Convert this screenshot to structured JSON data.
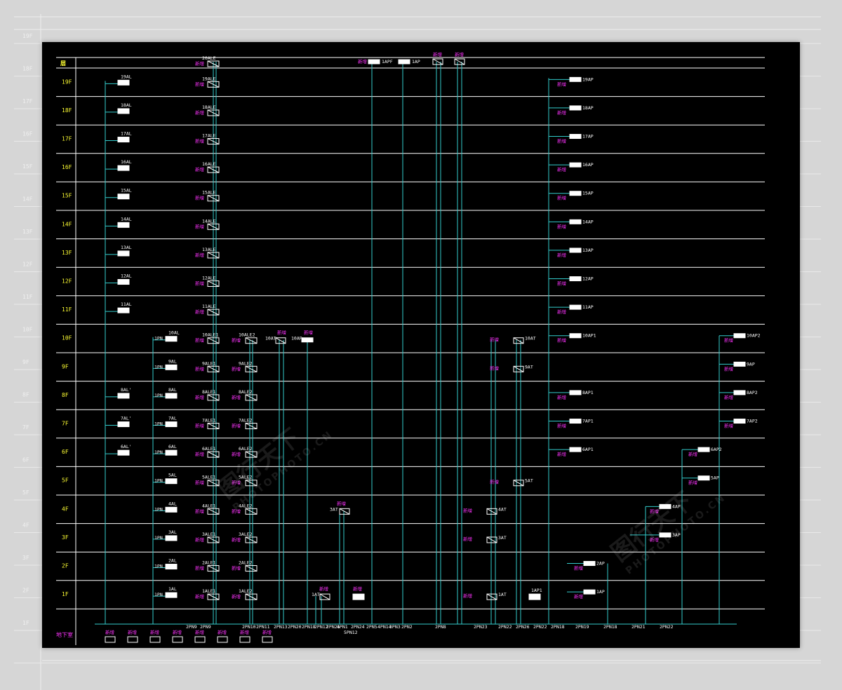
{
  "colors": {
    "page_bg": "#d6d6d6",
    "panel_bg": "#000000",
    "grid_line": "#ffffff",
    "riser": "#33cccc",
    "floor_label": "#ffff33",
    "magenta_label": "#ff33ff",
    "white_label": "#ffffff"
  },
  "header": {
    "corner_label": "层",
    "bottom_label": "地下室"
  },
  "floors": [
    "19F",
    "18F",
    "17F",
    "16F",
    "15F",
    "14F",
    "13F",
    "12F",
    "11F",
    "10F",
    "9F",
    "8F",
    "7F",
    "6F",
    "5F",
    "4F",
    "3F",
    "2F",
    "1F"
  ],
  "columns": {
    "lighting": [
      "19AL",
      "18AL",
      "17AL",
      "16AL",
      "15AL",
      "14AL",
      "13AL",
      "12AL",
      "11AL",
      "8AL'",
      "7AL'",
      "6AL'"
    ],
    "lighting_b": [
      "10AL",
      "9AL",
      "8AL",
      "7AL",
      "6AL",
      "5AL",
      "4AL",
      "3AL",
      "2AL",
      "1AL"
    ],
    "lighting_b_prefix": "1PN",
    "emergency": [
      "20ALE",
      "19ALE",
      "18ALE",
      "17ALE",
      "16ALE",
      "15ALE",
      "14ALE",
      "13ALE",
      "12ALE",
      "11ALE",
      "10ALE1",
      "9ALE1",
      "8ALE1",
      "7ALE1",
      "6ALE1",
      "5ALE1",
      "4ALE1",
      "3ALE1",
      "2ALE1",
      "1ALE1"
    ],
    "emergency_2": [
      "10ALE2",
      "9ALE2",
      "8ALE2",
      "7ALE2",
      "6ALE2",
      "5ALE2",
      "4ALE2",
      "3ALE2",
      "2ALE2",
      "1ALE2"
    ],
    "power_right": [
      "19AP",
      "18AP",
      "17AP",
      "16AP",
      "15AP",
      "14AP",
      "13AP",
      "12AP",
      "11AP",
      "10AP1",
      "8AP1",
      "7AP1",
      "6AP1"
    ],
    "power_far": [
      "10AP2",
      "9AP",
      "8AP2",
      "7AP2",
      "6AP2",
      "5AP",
      "4AP",
      "3AP",
      "2AP",
      "1AP"
    ],
    "transfer": [
      "10AT",
      "9AT",
      "5AT",
      "4AT",
      "3AT",
      "1AT"
    ],
    "misc": [
      "10AT",
      "10AP",
      "3AT",
      "1AT",
      "1AP1"
    ],
    "roof": [
      "1APF",
      "1AP"
    ]
  },
  "bus_labels": [
    "2PN9",
    "2PN9",
    "2PN10",
    "2PN11",
    "2PN13",
    "2PN20",
    "2PN18",
    "2PN12",
    "2PN25",
    "4PN1",
    "2PN24",
    "2PN5",
    "4PN14",
    "3PN3",
    "2PN2",
    "2PN8",
    "2PN23",
    "2PN22",
    "2PN26",
    "2PN22",
    "2PN18",
    "2PN19",
    "2PN18",
    "2PN21",
    "2PN22"
  ],
  "bus_center": "5PN12",
  "misc_magenta": "新增",
  "watermarks": [
    {
      "main": "图行天下",
      "sub": "PHOTOPHOTO.CN"
    },
    {
      "main": "图行天下",
      "sub": "PHOTOPHOTO.CN"
    }
  ]
}
